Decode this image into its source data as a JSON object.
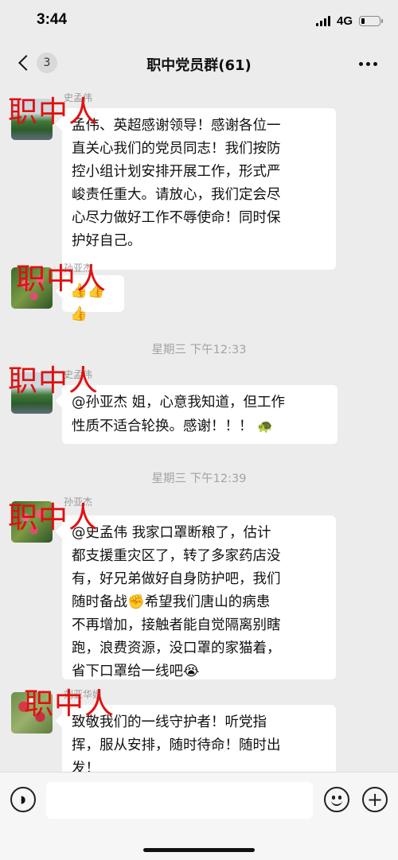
{
  "status_bar": {
    "time": "3:44",
    "network": "4G",
    "battery_level": 0.2
  },
  "nav": {
    "unread_count": "3",
    "title": "职中党员群(61)",
    "icons": {
      "back": "chevron-left-icon",
      "more": "more-dots-icon"
    }
  },
  "watermark": "职中人",
  "messages": [
    {
      "sender": "史孟伟",
      "avatar": "landscape",
      "text": "孟伟、英超感谢领导！感谢各位一直关心我们的党员同志！我们按防控小组计划安排开展工作，形式严峻责任重大。请放心，我们定会尽心尽力做好工作不辱使命！同时保护好自己。",
      "lines": [
        "孟伟、英超感谢领导！感谢各位一",
        "直关心我们的党员同志！我们按防",
        "控小组计划安排开展工作，形式严",
        "峻责任重大。请放心，我们定会尽",
        "心尽力做好工作不辱使命！同时保",
        "护好自己。"
      ]
    },
    {
      "sender": "孙亚杰",
      "avatar": "flowers",
      "text": "👍👍👍"
    },
    {
      "timestamp": "星期三 下午12:33"
    },
    {
      "sender": "史孟伟",
      "avatar": "landscape",
      "lines": [
        "@孙亚杰 姐，心意我知道，但工作",
        "性质不适合轮换。感谢！！！"
      ],
      "trailing_emoji": "🐢"
    },
    {
      "timestamp": "星期三 下午12:39"
    },
    {
      "sender": "孙亚杰",
      "avatar": "flowers",
      "lines": [
        "@史孟伟 我家口罩断粮了，估计",
        "都支援重灾区了，转了多家药店没",
        "有，好兄弟做好自身防护吧，我们",
        "随时备战✊希望我们唐山的病患",
        "不再增加，接触者能自觉隔离别瞎",
        "跑，浪费资源，没口罩的家猫着，",
        "省下口罩给一线吧😭"
      ]
    },
    {
      "sender": "刘亚华姐",
      "avatar": "redflowers",
      "lines": [
        "致敬我们的一线守护者！听党指",
        "挥，服从安排，随时待命！随时出",
        "发！"
      ]
    }
  ],
  "input_bar": {
    "icons": {
      "voice": "voice-icon",
      "emoji": "emoji-icon",
      "plus": "plus-icon"
    }
  }
}
